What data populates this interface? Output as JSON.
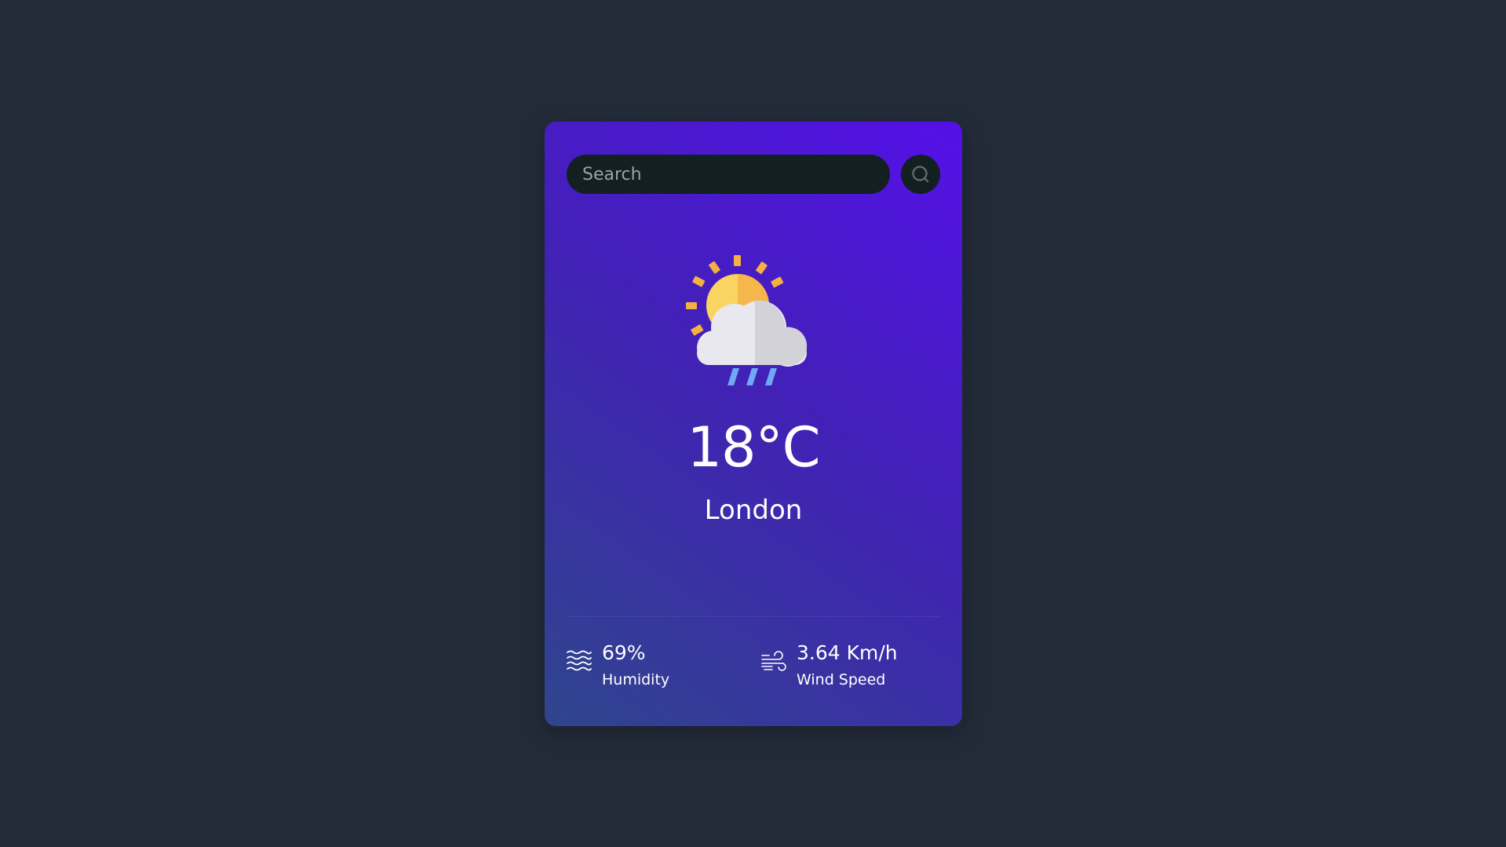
{
  "search": {
    "placeholder": "Search",
    "button_icon": "search-icon"
  },
  "weather": {
    "icon": "sun-cloud-rain-icon",
    "temperature": "18°C",
    "city": "London"
  },
  "stats": {
    "humidity": {
      "icon": "humidity-waves-icon",
      "value": "69%",
      "label": "Humidity"
    },
    "wind": {
      "icon": "wind-icon",
      "value": "3.64 Km/h",
      "label": "Wind Speed"
    }
  },
  "colors": {
    "page_background": "#232b39",
    "card_gradient_top": "#5510e8",
    "card_gradient_bottom": "#2f458d",
    "search_background": "#122022",
    "text": "#ffffff",
    "sun": "#f8c957",
    "cloud": "#e9e8ee",
    "rain": "#6fa8f3"
  }
}
